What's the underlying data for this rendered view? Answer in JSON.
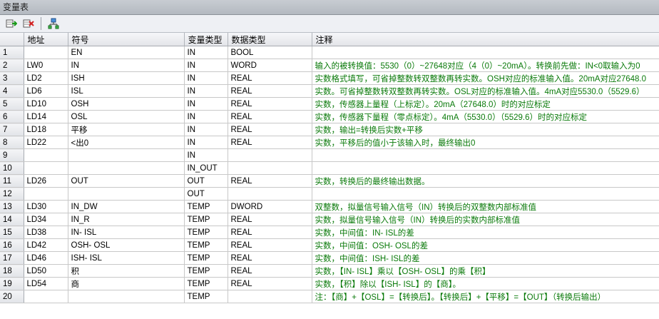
{
  "window": {
    "title": "变量表"
  },
  "toolbar": {
    "buttons": [
      {
        "name": "insert-row",
        "icon": "insert-row-icon"
      },
      {
        "name": "delete-row",
        "icon": "delete-row-icon"
      },
      {
        "name": "interface-params",
        "icon": "tree-icon"
      }
    ]
  },
  "columns": {
    "address": "地址",
    "symbol": "符号",
    "var_type": "变量类型",
    "data_type": "数据类型",
    "comment": "注释"
  },
  "rows": [
    {
      "num": "1",
      "addr": "",
      "sym": "EN",
      "vt": "IN",
      "dt": "BOOL",
      "cmt": ""
    },
    {
      "num": "2",
      "addr": "LW0",
      "sym": "IN",
      "vt": "IN",
      "dt": "WORD",
      "cmt": "输入的被转换值：5530（0）~27648对应（4（0）~20mA）。转换前先做：IN<0取输入为0"
    },
    {
      "num": "3",
      "addr": "LD2",
      "sym": "ISH",
      "vt": "IN",
      "dt": "REAL",
      "cmt": "实数格式填写，可省掉整数转双整数再转实数。OSH对应的标准输入值。20mA对应27648.0"
    },
    {
      "num": "4",
      "addr": "LD6",
      "sym": "ISL",
      "vt": "IN",
      "dt": "REAL",
      "cmt": "实数。可省掉整数转双整数再转实数。OSL对应的标准输入值。4mA对应5530.0（5529.6）"
    },
    {
      "num": "5",
      "addr": "LD10",
      "sym": "OSH",
      "vt": "IN",
      "dt": "REAL",
      "cmt": "实数，传感器上量程（上标定）。20mA（27648.0）时的对应标定"
    },
    {
      "num": "6",
      "addr": "LD14",
      "sym": "OSL",
      "vt": "IN",
      "dt": "REAL",
      "cmt": "实数，传感器下量程（零点标定）。4mA（5530.0）（5529.6）时的对应标定"
    },
    {
      "num": "7",
      "addr": "LD18",
      "sym": "平移",
      "vt": "IN",
      "dt": "REAL",
      "cmt": "实数，输出=转换后实数+平移"
    },
    {
      "num": "8",
      "addr": "LD22",
      "sym": "<出0",
      "vt": "IN",
      "dt": "REAL",
      "cmt": "实数，平移后的值小于该输入时，最终输出0"
    },
    {
      "num": "9",
      "addr": "",
      "sym": "",
      "vt": "IN",
      "dt": "",
      "cmt": ""
    },
    {
      "num": "10",
      "addr": "",
      "sym": "",
      "vt": "IN_OUT",
      "dt": "",
      "cmt": ""
    },
    {
      "num": "11",
      "addr": "LD26",
      "sym": "OUT",
      "vt": "OUT",
      "dt": "REAL",
      "cmt": "实数，转换后的最终输出数据。"
    },
    {
      "num": "12",
      "addr": "",
      "sym": "",
      "vt": "OUT",
      "dt": "",
      "cmt": ""
    },
    {
      "num": "13",
      "addr": "LD30",
      "sym": "IN_DW",
      "vt": "TEMP",
      "dt": "DWORD",
      "cmt": "双整数，拟量信号输入信号（IN）转换后的双整数内部标准值"
    },
    {
      "num": "14",
      "addr": "LD34",
      "sym": "IN_R",
      "vt": "TEMP",
      "dt": "REAL",
      "cmt": "实数，拟量信号输入信号（IN）转换后的实数内部标准值"
    },
    {
      "num": "15",
      "addr": "LD38",
      "sym": "IN- ISL",
      "vt": "TEMP",
      "dt": "REAL",
      "cmt": "实数，中间值：IN- ISL的差"
    },
    {
      "num": "16",
      "addr": "LD42",
      "sym": "OSH- OSL",
      "vt": "TEMP",
      "dt": "REAL",
      "cmt": "实数，中间值：OSH- OSL的差"
    },
    {
      "num": "17",
      "addr": "LD46",
      "sym": "ISH- ISL",
      "vt": "TEMP",
      "dt": "REAL",
      "cmt": "实数，中间值：ISH- ISL的差"
    },
    {
      "num": "18",
      "addr": "LD50",
      "sym": "积",
      "vt": "TEMP",
      "dt": "REAL",
      "cmt": "实数，【IN- ISL】乘以【OSH- OSL】的乘【积】"
    },
    {
      "num": "19",
      "addr": "LD54",
      "sym": "商",
      "vt": "TEMP",
      "dt": "REAL",
      "cmt": "实数，【积】除以【ISH- ISL】的【商】。"
    },
    {
      "num": "20",
      "addr": "",
      "sym": "",
      "vt": "TEMP",
      "dt": "",
      "cmt": "注：【商】+【OSL】=【转换后】。【转换后】+【平移】=【OUT】（转换后输出）"
    }
  ]
}
